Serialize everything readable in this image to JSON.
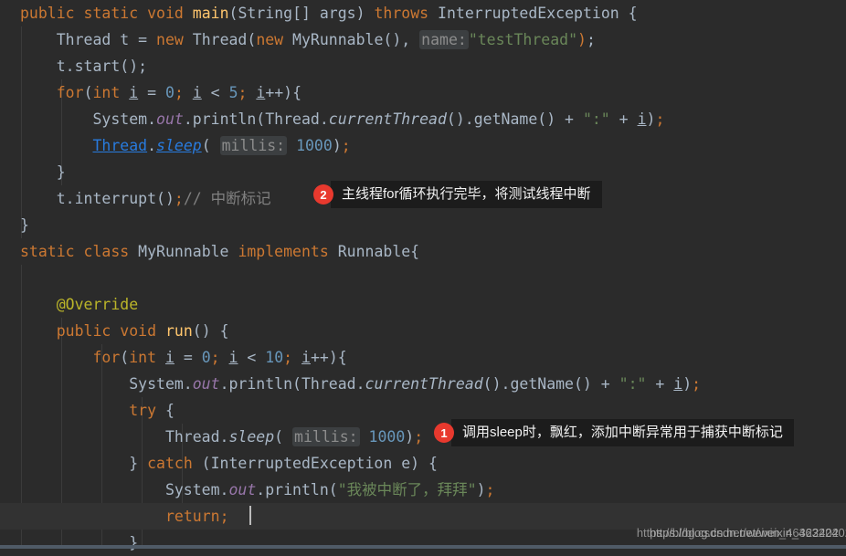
{
  "editor": {
    "background": "#2b2b2b",
    "current_line_background": "#323232",
    "default_text_color": "#a9b7c6",
    "lines": [
      {
        "indent": 0,
        "text": "public static void main(String[] args) throws InterruptedException {"
      },
      {
        "indent": 1,
        "text": "Thread t = new Thread(new MyRunnable(),  name: \"testThread\");"
      },
      {
        "indent": 1,
        "text": "t.start();"
      },
      {
        "indent": 1,
        "text": "for(int i = 0; i < 5; i++){"
      },
      {
        "indent": 2,
        "text": "System.out.println(Thread.currentThread().getName() + \":\" + i);"
      },
      {
        "indent": 2,
        "text": "Thread.sleep( millis: 1000);"
      },
      {
        "indent": 1,
        "text": "}"
      },
      {
        "indent": 1,
        "text": "t.interrupt();// 中断标记"
      },
      {
        "indent": 0,
        "text": "}"
      },
      {
        "indent": 0,
        "text": "static class MyRunnable implements Runnable{"
      },
      {
        "indent": 0,
        "text": ""
      },
      {
        "indent": 1,
        "text": "@Override"
      },
      {
        "indent": 1,
        "text": "public void run() {"
      },
      {
        "indent": 2,
        "text": "for(int i = 0; i < 10; i++){"
      },
      {
        "indent": 3,
        "text": "System.out.println(Thread.currentThread().getName() + \":\" + i);"
      },
      {
        "indent": 3,
        "text": "try {"
      },
      {
        "indent": 4,
        "text": "Thread.sleep( millis: 1000);"
      },
      {
        "indent": 3,
        "text": "} catch (InterruptedException e) {"
      },
      {
        "indent": 4,
        "text": "System.out.println(\"我被中断了，拜拜\");"
      },
      {
        "indent": 4,
        "text": "return;"
      },
      {
        "indent": 3,
        "text": "}"
      }
    ],
    "inline_hints": [
      "name:",
      "millis:"
    ],
    "literal_numbers": [
      "0",
      "5",
      "1000",
      "10"
    ],
    "strings": [
      "\"testThread\"",
      "\":\"",
      "\"我被中断了，拜拜\""
    ],
    "comment": "// 中断标记",
    "annotation": "@Override",
    "current_line_index": 19
  },
  "callouts": [
    {
      "number": "2",
      "text": "主线程for循环执行完毕，将测试线程中断",
      "badge_color": "#e8392e",
      "bubble_color": "#1c1c1c"
    },
    {
      "number": "1",
      "text": "调用sleep时，飘红，添加中断异常用于捕获中断标记",
      "badge_color": "#e8392e",
      "bubble_color": "#1c1c1c"
    }
  ],
  "watermark": {
    "primary": "https://blog.csdn.net/weixin_46322402",
    "secondary": "https://blog.csdn.net/weixin_46322402"
  },
  "status_bar": {
    "color": "#4f5a66"
  },
  "tokens": {
    "keyword_color": "#cc7832",
    "method_color": "#ffc66d",
    "number_color": "#6897bb",
    "string_color": "#6a8759",
    "comment_color": "#808080",
    "annotation_color": "#bbb529",
    "field_color": "#9876aa",
    "link_color": "#287bde",
    "hint_background": "#3c3f41",
    "hint_color": "#8c8c8c"
  }
}
